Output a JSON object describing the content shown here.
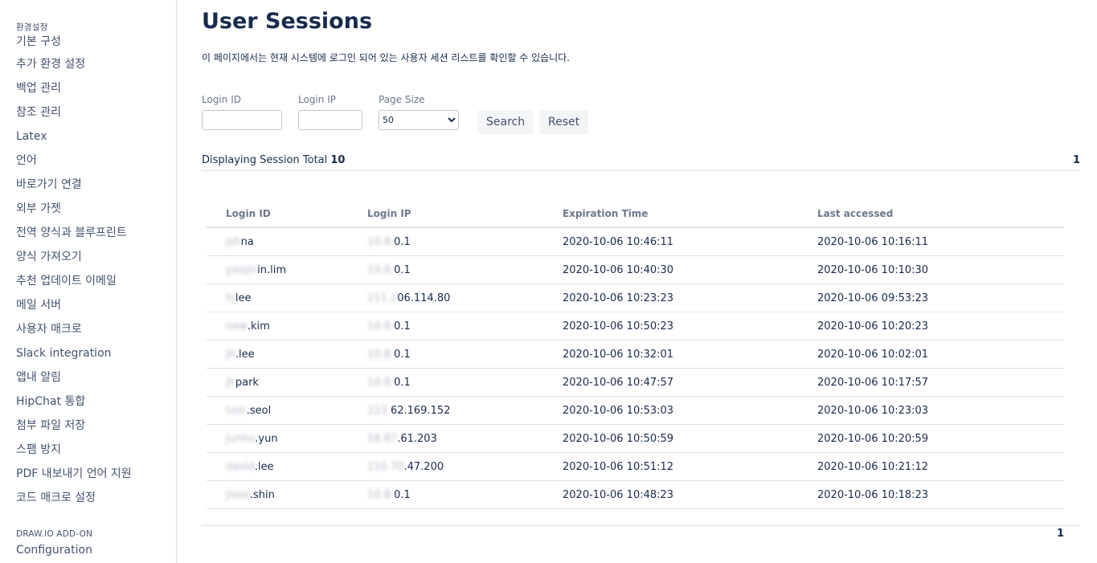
{
  "sidebar": {
    "section1": "환경설정",
    "items": [
      "기본 구성",
      "추가 환경 설정",
      "백업 관리",
      "참조 관리",
      "Latex",
      "언어",
      "바로가기 연결",
      "외부 가젯",
      "전역 양식과 블루프린트",
      "양식 가져오기",
      "추천 업데이트 이메일",
      "메일 서버",
      "사용자 매크로",
      "Slack integration",
      "앱내 알림",
      "HipChat 통합",
      "첨부 파일 저장",
      "스팸 방지",
      "PDF 내보내기 언어 지원",
      "코드 매크로 설정"
    ],
    "section2": "DRAW.IO ADD-ON",
    "items2": [
      "Configuration"
    ]
  },
  "page": {
    "title": "User Sessions",
    "description": "이 페이지에서는 현재 시스템에 로그인 되어 있는 사용자 세션 리스트를 확인할 수 있습니다."
  },
  "filters": {
    "login_id_label": "Login ID",
    "login_id_value": "",
    "login_ip_label": "Login IP",
    "login_ip_value": "",
    "page_size_label": "Page Size",
    "page_size_value": "50",
    "search_label": "Search",
    "reset_label": "Reset"
  },
  "summary": {
    "text": "Displaying Session Total",
    "total": "10",
    "page": "1"
  },
  "table": {
    "headers": [
      "Login ID",
      "Login IP",
      "Expiration Time",
      "Last accessed"
    ],
    "rows": [
      {
        "id_hidden": "jsh",
        "id": "na",
        "ip_hidden": "10.8.",
        "ip": "0.1",
        "exp": "2020-10-06 10:46:11",
        "last": "2020-10-06 10:16:11"
      },
      {
        "id_hidden": "yeojin",
        "id": "in.lim",
        "ip_hidden": "10.8.",
        "ip": "0.1",
        "exp": "2020-10-06 10:40:30",
        "last": "2020-10-06 10:10:30"
      },
      {
        "id_hidden": "hj",
        "id": "lee",
        "ip_hidden": "211.2",
        "ip": "06.114.80",
        "exp": "2020-10-06 10:23:23",
        "last": "2020-10-06 09:53:23"
      },
      {
        "id_hidden": "new",
        "id": ".kim",
        "ip_hidden": "10.8.",
        "ip": "0.1",
        "exp": "2020-10-06 10:50:23",
        "last": "2020-10-06 10:20:23"
      },
      {
        "id_hidden": "jh",
        "id": ".lee",
        "ip_hidden": "10.8.",
        "ip": "0.1",
        "exp": "2020-10-06 10:32:01",
        "last": "2020-10-06 10:02:01"
      },
      {
        "id_hidden": "jh",
        "id": "park",
        "ip_hidden": "10.8.",
        "ip": "0.1",
        "exp": "2020-10-06 10:47:57",
        "last": "2020-10-06 10:17:57"
      },
      {
        "id_hidden": "tom",
        "id": ".seol",
        "ip_hidden": "223.",
        "ip": "62.169.152",
        "exp": "2020-10-06 10:53:03",
        "last": "2020-10-06 10:23:03"
      },
      {
        "id_hidden": "junho",
        "id": ".yun",
        "ip_hidden": "58.87",
        "ip": ".61.203",
        "exp": "2020-10-06 10:50:59",
        "last": "2020-10-06 10:20:59"
      },
      {
        "id_hidden": "david",
        "id": ".lee",
        "ip_hidden": "110.70",
        "ip": ".47.200",
        "exp": "2020-10-06 10:51:12",
        "last": "2020-10-06 10:21:12"
      },
      {
        "id_hidden": "jisoo",
        "id": ".shin",
        "ip_hidden": "10.8.",
        "ip": "0.1",
        "exp": "2020-10-06 10:48:23",
        "last": "2020-10-06 10:18:23"
      }
    ]
  },
  "footer": {
    "page": "1"
  }
}
